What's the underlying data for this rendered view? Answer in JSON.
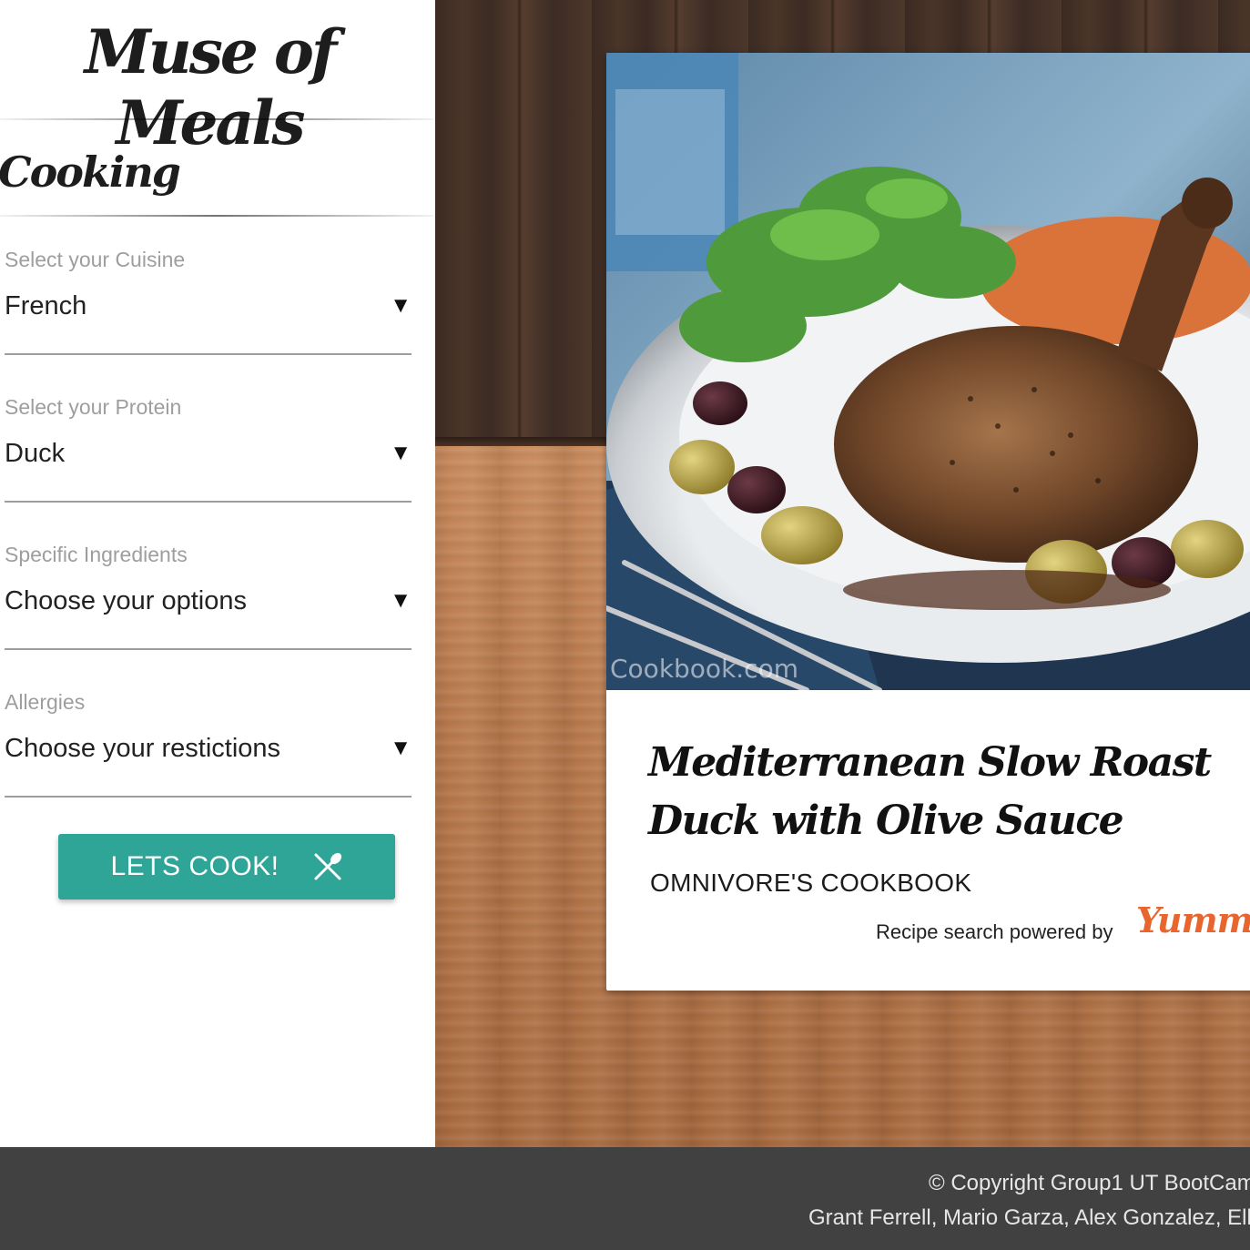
{
  "header": {
    "brand": "Muse of Meals"
  },
  "sidebar": {
    "section_title": "Cooking",
    "fields": [
      {
        "label": "Select your Cuisine",
        "value": "French"
      },
      {
        "label": "Select your Protein",
        "value": "Duck"
      },
      {
        "label": "Specific Ingredients",
        "value": "Choose your options"
      },
      {
        "label": "Allergies",
        "value": "Choose your restictions"
      }
    ],
    "caret": "▼",
    "cook_button": {
      "label": "LETS COOK!",
      "icon": "fork-knife-icon"
    }
  },
  "recipe": {
    "photo_description_icon": "roast-duck-photo",
    "photo_watermark": "Cookbook.com",
    "title": "Mediterranean Slow Roast Duck with Olive Sauce",
    "source": "OMNIVORE'S COOKBOOK",
    "powered_by": "Recipe search powered by",
    "provider_logo": "Yummly"
  },
  "footer": {
    "copyright": "© Copyright Group1 UT BootCam",
    "credits": "Grant Ferrell, Mario Garza, Alex Gonzalez, Ellic"
  },
  "colors": {
    "accent": "#2ea597",
    "footer_bg": "#414141",
    "yummly": "#e8662e"
  }
}
